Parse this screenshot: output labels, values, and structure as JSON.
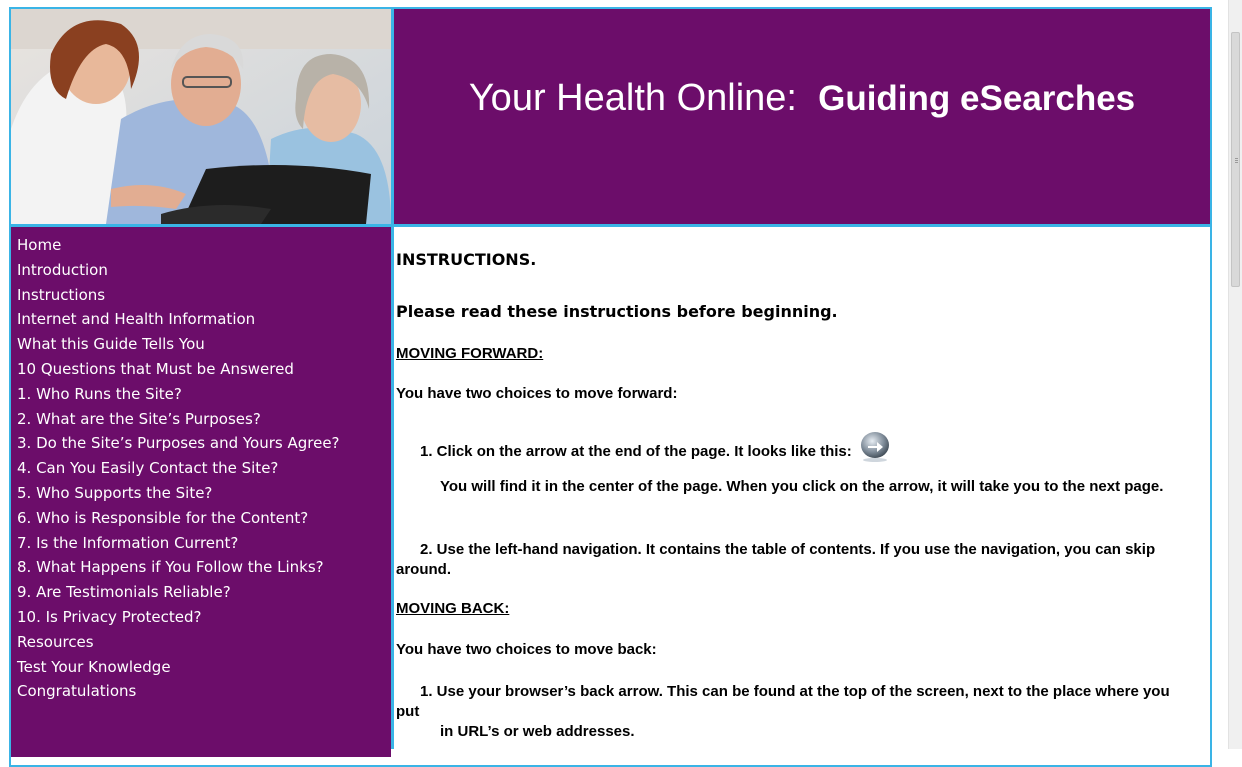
{
  "header": {
    "title_regular": "Your Health Online:",
    "title_bold": "Guiding eSearches"
  },
  "photo": {
    "icon": "photo-of-three-people-at-laptop"
  },
  "sidebar": {
    "items": [
      {
        "label": "Home"
      },
      {
        "label": "Introduction"
      },
      {
        "label": "Instructions"
      },
      {
        "label": "Internet and Health Information"
      },
      {
        "label": "What this Guide Tells You"
      },
      {
        "label": "10 Questions that Must be Answered"
      },
      {
        "label": "1. Who Runs the Site?"
      },
      {
        "label": "2. What are the Site’s Purposes?"
      },
      {
        "label": "3. Do the Site’s Purposes and Yours Agree?"
      },
      {
        "label": "4. Can You Easily Contact the Site?"
      },
      {
        "label": "5. Who Supports the Site?"
      },
      {
        "label": "6. Who is Responsible for the Content?"
      },
      {
        "label": "7. Is the Information Current?"
      },
      {
        "label": "8. What Happens if You Follow the Links?"
      },
      {
        "label": "9. Are Testimonials Reliable?"
      },
      {
        "label": "10. Is Privacy Protected?"
      },
      {
        "label": "Resources"
      },
      {
        "label": "Test Your Knowledge"
      },
      {
        "label": "Congratulations"
      }
    ]
  },
  "content": {
    "heading": "INSTRUCTIONS.",
    "intro": "Please read these instructions before beginning.",
    "forward_heading": "MOVING FORWARD:",
    "forward_intro": "You have two choices to move forward:",
    "forward_1": "1. Click on the arrow at the end of the page. It looks like this:",
    "forward_1_note": "You will find it in the center of the page. When you click on the arrow, it will take you to the next page.",
    "forward_2": "2. Use the left-hand navigation. It contains the table of contents. If you use the navigation, you can skip around.",
    "back_heading": "MOVING BACK:",
    "back_intro": "You have two choices to move back:",
    "back_1": "1. Use your browser’s back arrow. This can be found at the top of the screen, next to the place where you put",
    "back_1_cont": "in URL’s or web addresses.",
    "arrow_icon": "next-arrow-icon"
  },
  "colors": {
    "purple": "#6c0d6a",
    "border_blue": "#3ab4e6",
    "white": "#ffffff"
  }
}
